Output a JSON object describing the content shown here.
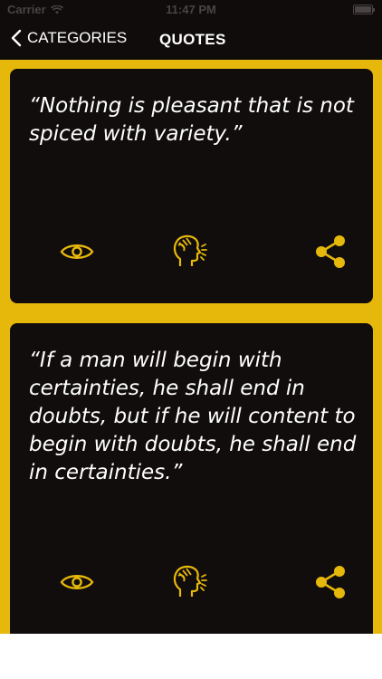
{
  "status_bar": {
    "carrier": "Carrier",
    "time": "11:47 PM"
  },
  "nav": {
    "back_label": "CATEGORIES",
    "title": "QUOTES"
  },
  "colors": {
    "accent": "#e6b80b",
    "card": "#120d0d",
    "bar": "#100c0c"
  },
  "quotes": [
    {
      "text": "“Nothing is pleasant that is not spiced with variety.”",
      "actions": [
        "eye-icon",
        "speaking-head-icon",
        "share-icon"
      ]
    },
    {
      "text": "“If a man will begin with certainties, he shall end in doubts, but if he will content to begin with doubts, he shall end in certainties.”",
      "actions": [
        "eye-icon",
        "speaking-head-icon",
        "share-icon"
      ]
    }
  ]
}
